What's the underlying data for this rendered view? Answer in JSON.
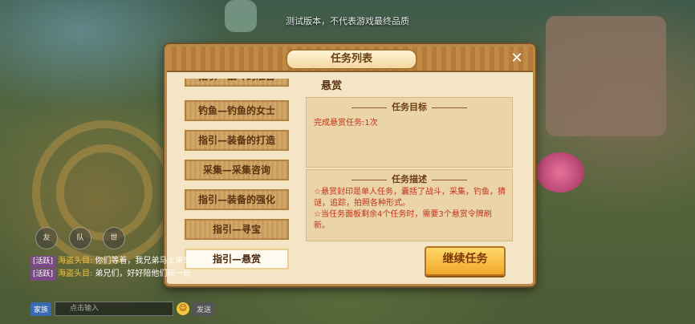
{
  "notice": "测试版本，不代表游戏最终品质",
  "dialog": {
    "title": "任务列表",
    "close_icon": "✕",
    "tabs": [
      {
        "label": "指引—战斗的准备"
      },
      {
        "label": "钓鱼—钓鱼的女士"
      },
      {
        "label": "指引—装备的打造"
      },
      {
        "label": "采集—采集咨询"
      },
      {
        "label": "指引—装备的强化"
      },
      {
        "label": "指引—寻宝"
      },
      {
        "label": "指引—悬赏",
        "active": true
      }
    ],
    "task_name": "悬赏",
    "goal": {
      "title": "任务目标",
      "text": "完成悬赏任务:1次"
    },
    "description": {
      "title": "任务描述",
      "line1": "☆悬赏封印是单人任务，囊括了战斗，采集，钓鱼，猜谜，追踪，拍照各种形式。",
      "line2": "☆当任务面板剩余4个任务时，需要3个悬赏令牌刷新。"
    },
    "continue_label": "继续任务"
  },
  "chat": {
    "icons": [
      {
        "label": "友",
        "icon": "friend-icon"
      },
      {
        "label": "队",
        "icon": "team-icon"
      },
      {
        "label": "世",
        "icon": "world-icon"
      }
    ],
    "lines": [
      {
        "channel": "[活跃]",
        "speaker": "海盗头目:",
        "text": "你们等着，我兄弟马上来！"
      },
      {
        "channel": "[活跃]",
        "speaker": "海盗头目:",
        "text": "弟兄们，好好陪他们玩一玩"
      }
    ],
    "channel_selected": "家族",
    "input_placeholder": "点击输入",
    "send_label": "发送"
  },
  "colors": {
    "accent": "#f0a82a",
    "frame": "#b88a4a",
    "red_text": "#c0331a"
  }
}
